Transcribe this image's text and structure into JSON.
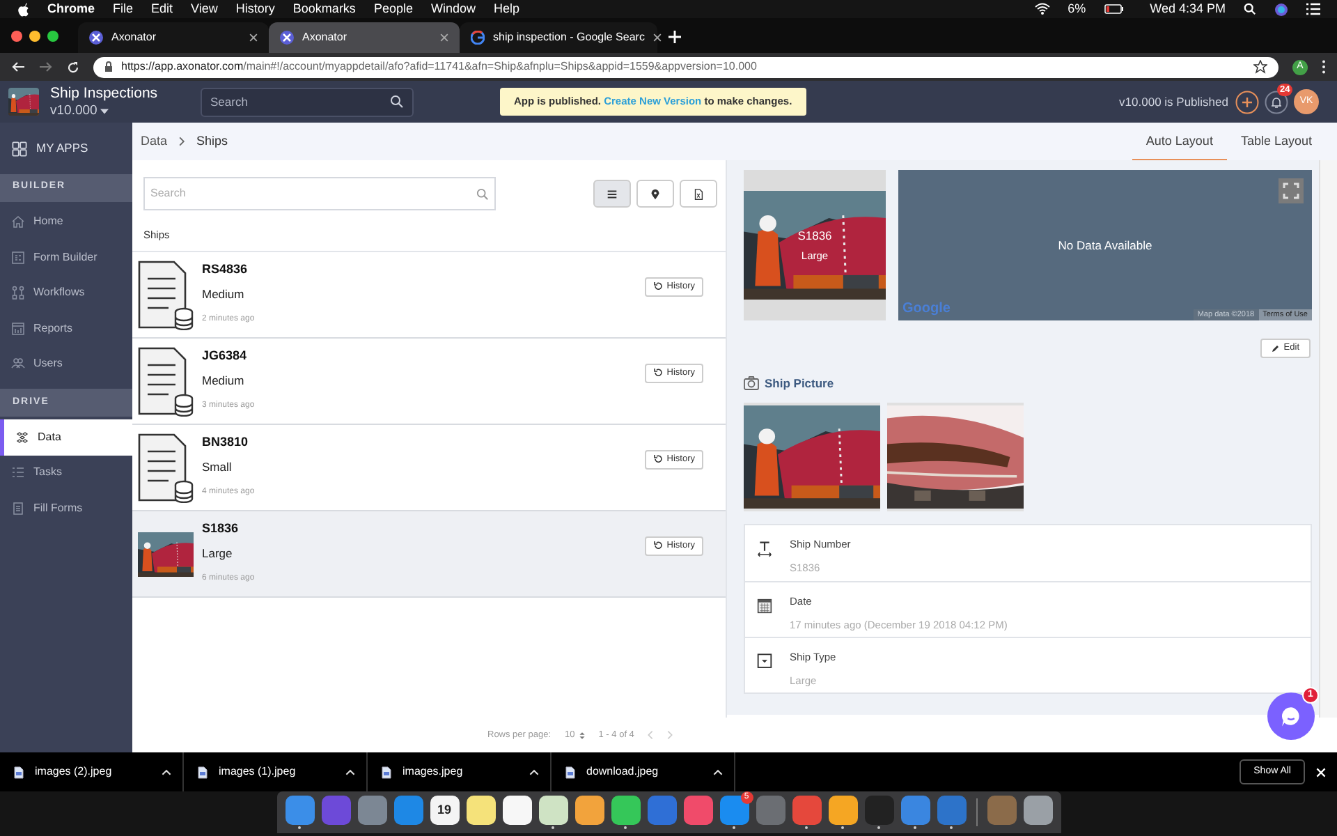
{
  "menubar": {
    "items": [
      "Chrome",
      "File",
      "Edit",
      "View",
      "History",
      "Bookmarks",
      "People",
      "Window",
      "Help"
    ],
    "battery": "6%",
    "clock": "Wed 4:34 PM"
  },
  "browser_tabs": [
    {
      "title": "Axonator",
      "selected": false
    },
    {
      "title": "Axonator",
      "selected": true
    },
    {
      "title": "ship inspection - Google Searc",
      "selected": false
    }
  ],
  "address_bar": {
    "host": "https://app.axonator.com",
    "path": "/main#!/account/myappdetail/afo?afid=11741&afn=Ship&afnplu=Ships&appid=1559&appversion=10.000",
    "profile": "A"
  },
  "header": {
    "app_name": "Ship Inspections",
    "version": "v10.000",
    "search_placeholder": "Search",
    "notice_before": "App is published.",
    "notice_link": "Create New Version",
    "notice_after": "to make changes.",
    "publish_status": "v10.000 is Published",
    "notifications": "24",
    "avatar": "VK"
  },
  "sidebar": {
    "items": [
      {
        "kind": "item",
        "label": "MY APPS",
        "selected": false
      },
      {
        "kind": "section",
        "label": "BUILDER"
      },
      {
        "kind": "item",
        "label": "Home",
        "selected": false
      },
      {
        "kind": "item",
        "label": "Form Builder",
        "selected": false
      },
      {
        "kind": "item",
        "label": "Workflows",
        "selected": false
      },
      {
        "kind": "item",
        "label": "Reports",
        "selected": false
      },
      {
        "kind": "item",
        "label": "Users",
        "selected": false
      },
      {
        "kind": "section",
        "label": "DRIVE"
      },
      {
        "kind": "item",
        "label": "Data",
        "selected": true
      },
      {
        "kind": "item",
        "label": "Tasks",
        "selected": false
      },
      {
        "kind": "item",
        "label": "Fill Forms",
        "selected": false
      }
    ]
  },
  "breadcrumb": [
    "Data",
    "Ships"
  ],
  "layout_tabs": [
    {
      "label": "Auto Layout",
      "selected": true
    },
    {
      "label": "Table Layout",
      "selected": false
    }
  ],
  "list": {
    "search_placeholder": "Search",
    "views": [
      {
        "selected": true
      },
      {
        "selected": false
      },
      {
        "selected": false
      }
    ],
    "title": "Ships",
    "rows": [
      {
        "kind": "document",
        "number": "RS4836",
        "type": "Medium",
        "time": "2 minutes ago",
        "action": "History",
        "selected": false
      },
      {
        "kind": "document",
        "number": "JG6384",
        "type": "Medium",
        "time": "3 minutes ago",
        "action": "History",
        "selected": false
      },
      {
        "kind": "document",
        "number": "BN3810",
        "type": "Small",
        "time": "4 minutes ago",
        "action": "History",
        "selected": false
      },
      {
        "kind": "picture",
        "number": "S1836",
        "type": "Large",
        "time": "6 minutes ago",
        "action": "History",
        "selected": true
      }
    ]
  },
  "pagination": {
    "label": "Rows per page:",
    "rows": "10",
    "range": "1 - 4 of 4"
  },
  "detail": {
    "cover_title": "S1836",
    "cover_subtitle": "Large",
    "map": {
      "message": "No Data Available",
      "logo": "Google",
      "attribution": "Map data ©2018",
      "terms": "Terms of Use"
    },
    "edit": "Edit",
    "picture_section": "Ship Picture",
    "fields": [
      {
        "kind": "text",
        "label": "Ship Number",
        "value": "S1836"
      },
      {
        "kind": "date",
        "label": "Date",
        "value": "17 minutes ago (December 19 2018 04:12 PM)"
      },
      {
        "kind": "choice",
        "label": "Ship Type",
        "value": "Large"
      }
    ]
  },
  "chat": {
    "badge": "1"
  },
  "downloads": {
    "files": [
      "images (2).jpeg",
      "images (1).jpeg",
      "images.jpeg",
      "download.jpeg"
    ],
    "show_all": "Show All"
  },
  "dock": [
    {
      "color": "#3b8ee8",
      "running": true
    },
    {
      "color": "#6d4ad8",
      "running": false
    },
    {
      "color": "#7c8794",
      "running": false
    },
    {
      "color": "#1e88e5",
      "running": false
    },
    {
      "color": "#f4f4f4",
      "running": false,
      "label": "19"
    },
    {
      "color": "#f5e27a",
      "running": false
    },
    {
      "color": "#f7f7f7",
      "running": false
    },
    {
      "color": "#cfe3c4",
      "running": true
    },
    {
      "color": "#f2a33c",
      "running": false
    },
    {
      "color": "#35c759",
      "running": true
    },
    {
      "color": "#2f6fd6",
      "running": false
    },
    {
      "color": "#f04b6a",
      "running": false
    },
    {
      "color": "#1a8cf0",
      "running": true,
      "badge": "5"
    },
    {
      "color": "#6b6e73",
      "running": false
    },
    {
      "color": "#e5483c",
      "running": true
    },
    {
      "color": "#f5a623",
      "running": true
    },
    {
      "color": "#222222",
      "running": true
    },
    {
      "color": "#3a86e0",
      "running": true
    },
    {
      "color": "#2d73c9",
      "running": true
    },
    {
      "color": "#8b6b4a",
      "running": false
    },
    {
      "color": "#9aa0a6",
      "running": false
    }
  ]
}
